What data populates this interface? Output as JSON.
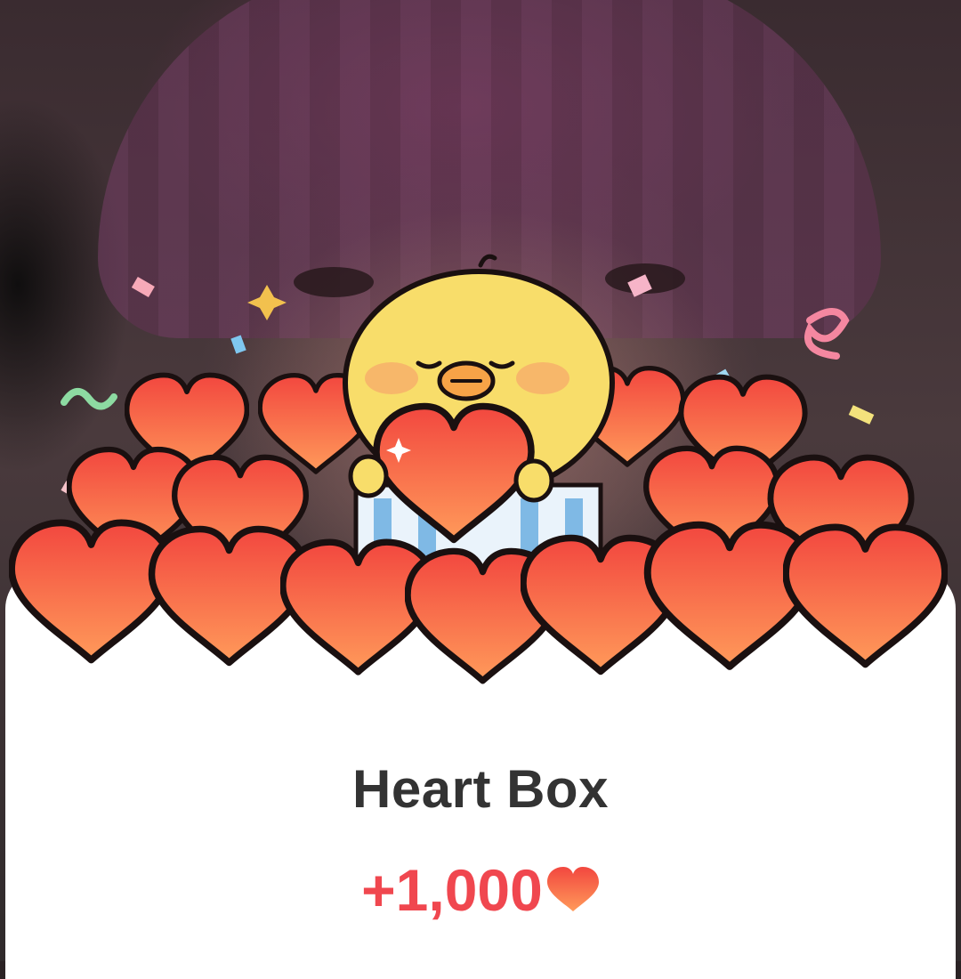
{
  "reward_popup": {
    "title": "Heart Box",
    "amount": "+1,000",
    "currency_icon": "heart-icon"
  },
  "colors": {
    "amount": "#f0474f",
    "title": "#333333",
    "heart_fill_top": "#f2473f",
    "heart_fill_bottom": "#ff9a5a",
    "chick_body": "#f8dd6a"
  }
}
